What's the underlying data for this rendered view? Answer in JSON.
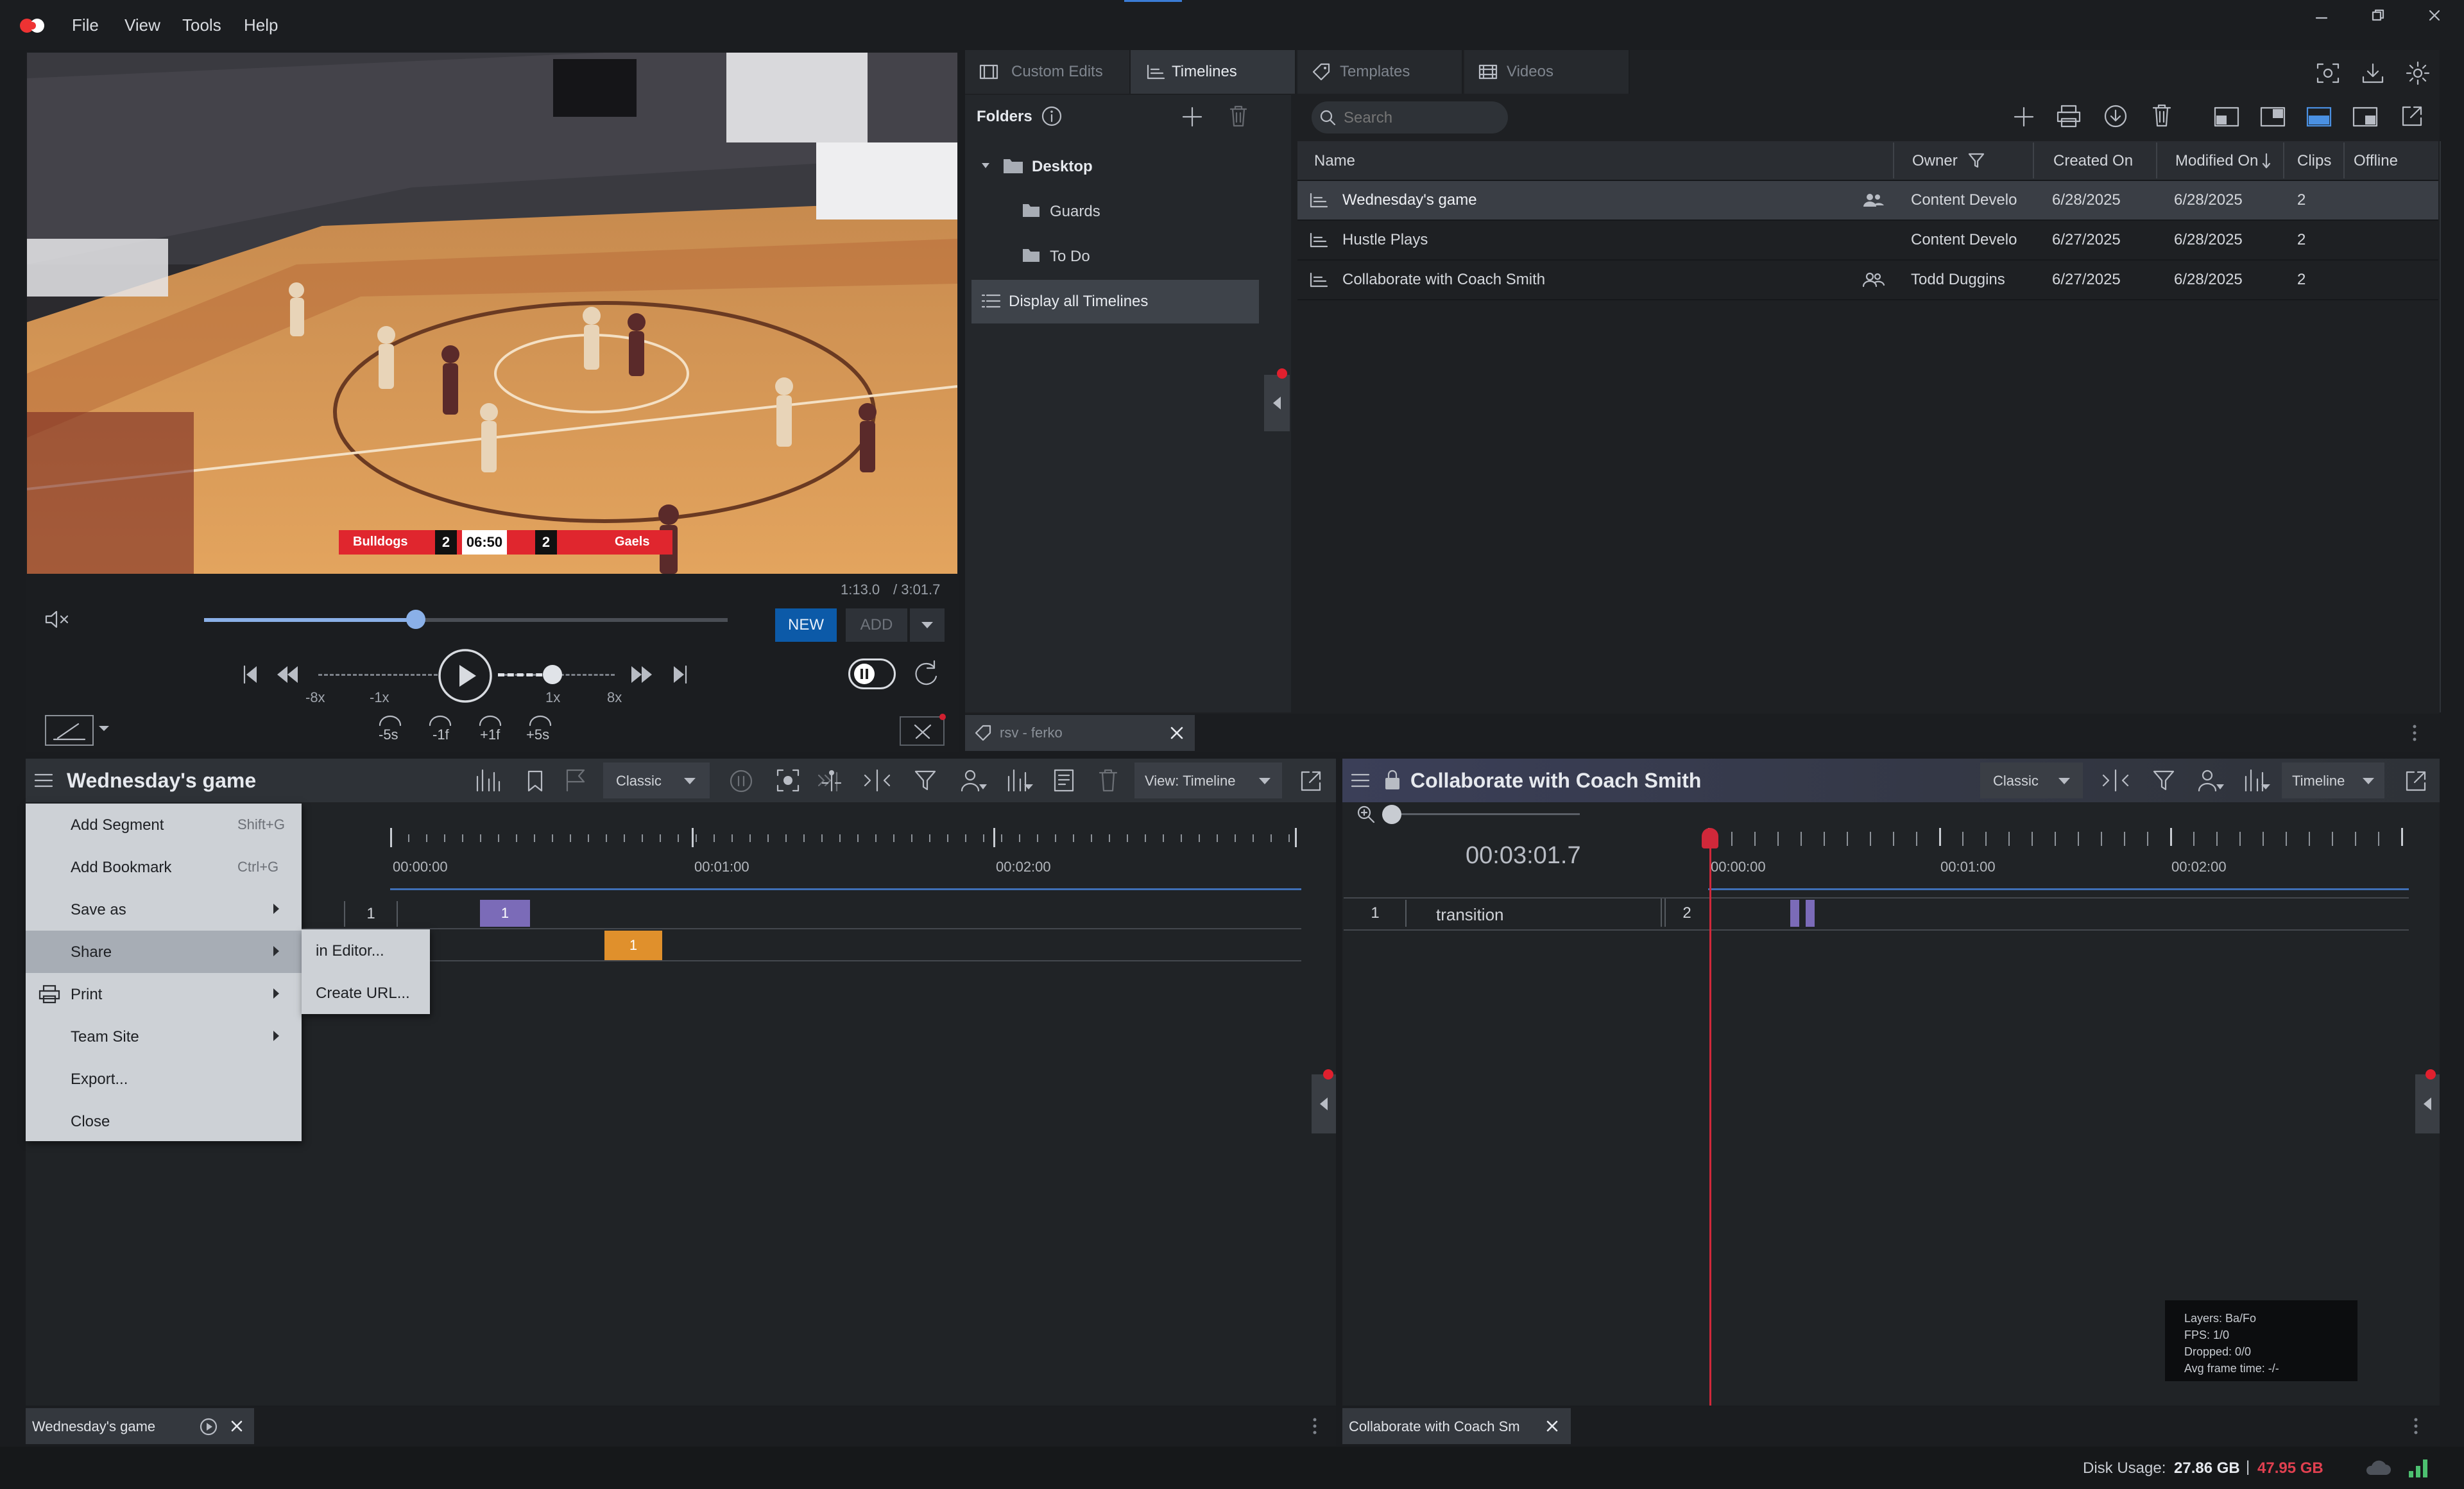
{
  "menubar": {
    "items": [
      "File",
      "View",
      "Tools",
      "Help"
    ]
  },
  "tabs": [
    {
      "label": "Custom Edits"
    },
    {
      "label": "Timelines",
      "active": true
    },
    {
      "label": "Templates"
    },
    {
      "label": "Videos"
    }
  ],
  "folders": {
    "title": "Folders",
    "tree": [
      {
        "label": "Desktop",
        "level": 0
      },
      {
        "label": "Guards",
        "level": 1
      },
      {
        "label": "To Do",
        "level": 1
      }
    ],
    "display_all": "Display all Timelines"
  },
  "search": {
    "placeholder": "Search"
  },
  "table": {
    "columns": {
      "name": "Name",
      "owner": "Owner",
      "created": "Created On",
      "modified": "Modified On",
      "clips": "Clips",
      "offline": "Offline"
    },
    "rows": [
      {
        "name": "Wednesday's game",
        "owner": "Content Develo",
        "created": "6/28/2025",
        "modified": "6/28/2025",
        "clips": "2",
        "shared": true,
        "selected": true
      },
      {
        "name": "Hustle Plays",
        "owner": "Content Develo",
        "created": "6/27/2025",
        "modified": "6/28/2025",
        "clips": "2",
        "shared": false
      },
      {
        "name": "Collaborate with Coach Smith",
        "owner": "Todd Duggins",
        "created": "6/27/2025",
        "modified": "6/28/2025",
        "clips": "2",
        "shared": true
      }
    ]
  },
  "scoreboard": {
    "home": "Bulldogs",
    "home_score": "2",
    "clock": "06:50",
    "away_score": "2",
    "away": "Gaels"
  },
  "player": {
    "time_current": "1:13.0",
    "time_total": "/ 3:01.7",
    "progress": 0.405,
    "new_label": "NEW",
    "add_label": "ADD",
    "speeds": [
      "-8x",
      "-1x",
      "1x",
      "8x"
    ],
    "steps": [
      "-5s",
      "-1f",
      "+1f",
      "+5s"
    ]
  },
  "tag_tab": {
    "label": "rsv - ferko"
  },
  "left_timeline": {
    "title": "Wednesday's game",
    "mode": "Classic",
    "view": "View: Timeline",
    "ruler": [
      "00:00:00",
      "00:01:00",
      "00:02:00"
    ],
    "row_number": "1",
    "clip1": "1",
    "clip2": "1",
    "bottom_tab": "Wednesday's game"
  },
  "context_menu": {
    "items": [
      {
        "label": "Add Segment",
        "shortcut": "Shift+G"
      },
      {
        "label": "Add Bookmark",
        "shortcut": "Ctrl+G"
      },
      {
        "label": "Save as",
        "submenu": true
      },
      {
        "label": "Share",
        "submenu": true,
        "highlight": true
      },
      {
        "label": "Print",
        "submenu": true,
        "icon": "printer-icon"
      },
      {
        "label": "Team Site",
        "submenu": true
      },
      {
        "label": "Export..."
      },
      {
        "label": "Close"
      }
    ],
    "share_submenu": [
      "in Editor...",
      "Create URL..."
    ]
  },
  "right_timeline": {
    "title": "Collaborate with Coach Smith",
    "mode": "Classic",
    "view": "Timeline",
    "timecode": "00:03:01.7",
    "ruler": [
      "00:00:00",
      "00:01:00",
      "00:02:00"
    ],
    "row1_num": "1",
    "row1_label": "transition",
    "row2_num": "2",
    "bottom_tab": "Collaborate with Coach Sm"
  },
  "stats": [
    "Layers: Ba/Fo",
    "FPS: 1/0",
    "Dropped: 0/0",
    "Avg frame time: -/-"
  ],
  "status": {
    "disk_label": "Disk Usage:",
    "used": "27.86 GB",
    "sep": "|",
    "total": "47.95 GB"
  },
  "colors": {
    "accent": "#4a90e2",
    "clip_purple": "#7b6bb8",
    "clip_orange": "#e0902c",
    "playhead": "#d0283a",
    "disk_total": "#e04050"
  }
}
